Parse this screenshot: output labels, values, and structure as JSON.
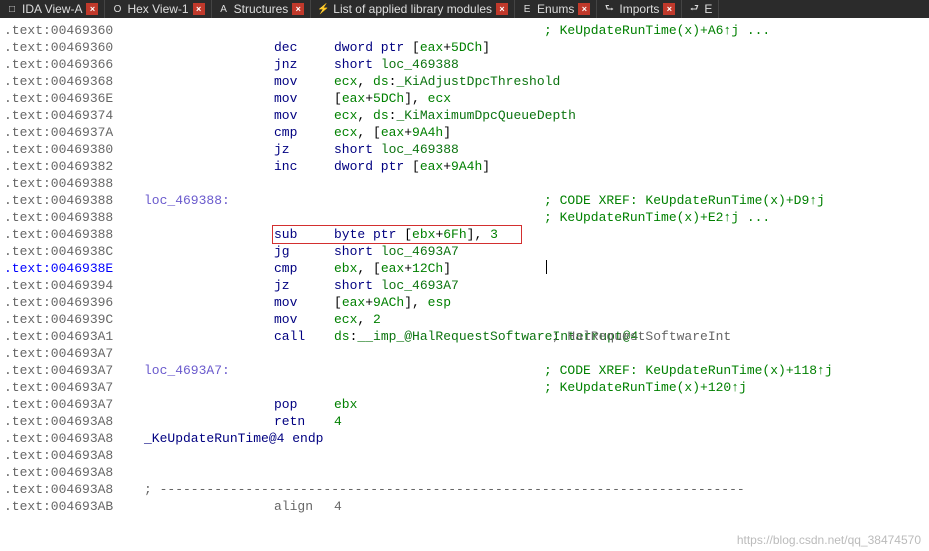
{
  "tabs": [
    {
      "label": "IDA View-A",
      "icon": "□"
    },
    {
      "label": "Hex View-1",
      "icon": "O"
    },
    {
      "label": "Structures",
      "icon": "A"
    },
    {
      "label": "List of applied library modules",
      "icon": "⚡"
    },
    {
      "label": "Enums",
      "icon": "E"
    },
    {
      "label": "Imports",
      "icon": "⮑"
    },
    {
      "label": "E",
      "icon": "⮐"
    }
  ],
  "lines": [
    {
      "addr": ".text:00469360",
      "label": "",
      "mnem": "",
      "op": "",
      "cmt": "; KeUpdateRunTime(x)+A6↑j ..."
    },
    {
      "addr": ".text:00469360",
      "label": "",
      "mnem": "dec",
      "op": "dword ptr [eax+5DCh]"
    },
    {
      "addr": ".text:00469366",
      "label": "",
      "mnem": "jnz",
      "op": "short loc_469388"
    },
    {
      "addr": ".text:00469368",
      "label": "",
      "mnem": "mov",
      "op": "ecx, ds:_KiAdjustDpcThreshold"
    },
    {
      "addr": ".text:0046936E",
      "label": "",
      "mnem": "mov",
      "op": "[eax+5DCh], ecx"
    },
    {
      "addr": ".text:00469374",
      "label": "",
      "mnem": "mov",
      "op": "ecx, ds:_KiMaximumDpcQueueDepth"
    },
    {
      "addr": ".text:0046937A",
      "label": "",
      "mnem": "cmp",
      "op": "ecx, [eax+9A4h]"
    },
    {
      "addr": ".text:00469380",
      "label": "",
      "mnem": "jz",
      "op": "short loc_469388"
    },
    {
      "addr": ".text:00469382",
      "label": "",
      "mnem": "inc",
      "op": "dword ptr [eax+9A4h]"
    },
    {
      "addr": ".text:00469388",
      "label": "",
      "mnem": "",
      "op": ""
    },
    {
      "addr": ".text:00469388",
      "label": "loc_469388:",
      "mnem": "",
      "op": "",
      "cmt": "; CODE XREF: KeUpdateRunTime(x)+D9↑j"
    },
    {
      "addr": ".text:00469388",
      "label": "",
      "mnem": "",
      "op": "",
      "cmt": "; KeUpdateRunTime(x)+E2↑j ..."
    },
    {
      "addr": ".text:00469388",
      "label": "",
      "mnem": "sub",
      "op": "byte ptr [ebx+6Fh], 3",
      "hl": true
    },
    {
      "addr": ".text:0046938C",
      "label": "",
      "mnem": "jg",
      "op": "short loc_4693A7"
    },
    {
      "addr": ".text:0046938E",
      "label": "",
      "mnem": "cmp",
      "op": "ebx, [eax+12Ch]",
      "blue": true,
      "cursor": true
    },
    {
      "addr": ".text:00469394",
      "label": "",
      "mnem": "jz",
      "op": "short loc_4693A7"
    },
    {
      "addr": ".text:00469396",
      "label": "",
      "mnem": "mov",
      "op": "[eax+9ACh], esp"
    },
    {
      "addr": ".text:0046939C",
      "label": "",
      "mnem": "mov",
      "op": "ecx, 2"
    },
    {
      "addr": ".text:004693A1",
      "label": "",
      "mnem": "call",
      "op": "ds:__imp_@HalRequestSoftwareInterrupt@4",
      "cmt2": " ; HalRequestSoftwareInt"
    },
    {
      "addr": ".text:004693A7",
      "label": "",
      "mnem": "",
      "op": ""
    },
    {
      "addr": ".text:004693A7",
      "label": "loc_4693A7:",
      "mnem": "",
      "op": "",
      "cmt": "; CODE XREF: KeUpdateRunTime(x)+118↑j"
    },
    {
      "addr": ".text:004693A7",
      "label": "",
      "mnem": "",
      "op": "",
      "cmt": "; KeUpdateRunTime(x)+120↑j"
    },
    {
      "addr": ".text:004693A7",
      "label": "",
      "mnem": "pop",
      "op": "ebx"
    },
    {
      "addr": ".text:004693A8",
      "label": "",
      "mnem": "retn",
      "op": "4"
    },
    {
      "addr": ".text:004693A8",
      "label": "_KeUpdateRunTime@4 endp",
      "endp": true
    },
    {
      "addr": ".text:004693A8"
    },
    {
      "addr": ".text:004693A8"
    },
    {
      "addr": ".text:004693A8",
      "sep": true
    },
    {
      "addr": ".text:004693AB",
      "label": "",
      "mnem": "align",
      "op": "4",
      "grayline": true
    }
  ],
  "watermark": "https://blog.csdn.net/qq_38474570"
}
